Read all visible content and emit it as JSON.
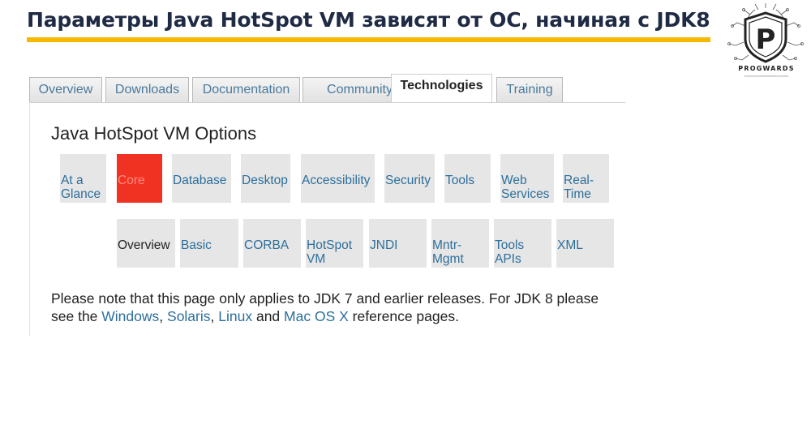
{
  "slide": {
    "title": "Параметры Java HotSpot VM зависят от ОС, начиная с JDK8"
  },
  "logo": {
    "name": "PROGWARDS",
    "letter": "P"
  },
  "tabs": [
    {
      "label": "Overview"
    },
    {
      "label": "Downloads"
    },
    {
      "label": "Documentation"
    },
    {
      "label": "Community"
    },
    {
      "label": "Technologies",
      "active": true
    },
    {
      "label": "Training"
    }
  ],
  "page": {
    "heading": "Java HotSpot VM Options"
  },
  "nav_primary": [
    {
      "label": "At a Glance"
    },
    {
      "label": "Core",
      "selected": true
    },
    {
      "label": "Database"
    },
    {
      "label": "Desktop"
    },
    {
      "label": "Accessibility"
    },
    {
      "label": "Security"
    },
    {
      "label": "Tools"
    },
    {
      "label": "Web Services"
    },
    {
      "label": "Real-Time"
    }
  ],
  "nav_secondary": [
    {
      "label": "Overview",
      "current": true
    },
    {
      "label": "Basic"
    },
    {
      "label": "CORBA"
    },
    {
      "label": "HotSpot VM"
    },
    {
      "label": "JNDI"
    },
    {
      "label": "Mntr-Mgmt"
    },
    {
      "label": "Tools APIs"
    },
    {
      "label": "XML"
    }
  ],
  "note": {
    "text_before": "Please note that this page only applies to JDK 7 and earlier releases. For JDK 8 please see the ",
    "link_windows": "Windows",
    "sep1": ", ",
    "link_solaris": "Solaris",
    "sep2": ", ",
    "link_linux": "Linux",
    "sep3": " and ",
    "link_macosx": "Mac OS X",
    "text_after": " reference pages."
  },
  "colors": {
    "accent_underline": "#f5b800",
    "selected_nav": "#f03222",
    "link": "#2c6f9b"
  }
}
